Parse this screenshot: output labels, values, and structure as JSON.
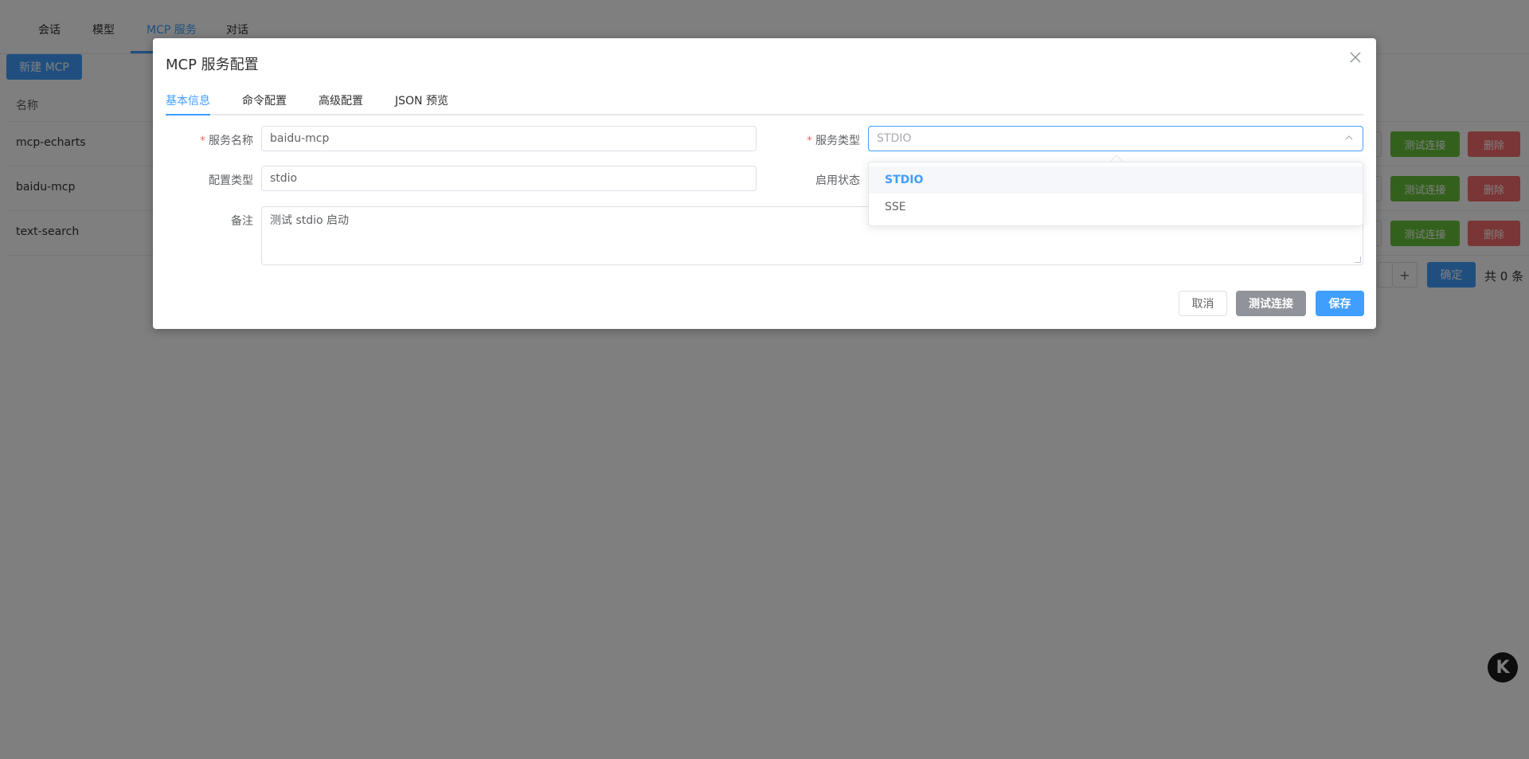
{
  "top_tabs": [
    {
      "label": "会话",
      "active": false
    },
    {
      "label": "模型",
      "active": false
    },
    {
      "label": "MCP 服务",
      "active": true
    },
    {
      "label": "对话",
      "active": false
    }
  ],
  "list": {
    "new_button": "新建 MCP",
    "column_name": "名称",
    "rows": [
      {
        "name": "mcp-echarts",
        "test_label": "测试连接",
        "delete_label": "删除"
      },
      {
        "name": "baidu-mcp",
        "test_label": "测试连接",
        "delete_label": "删除"
      },
      {
        "name": "text-search",
        "test_label": "测试连接",
        "delete_label": "删除"
      }
    ],
    "pager": {
      "plus": "+",
      "ok_label": "确定",
      "total": "共 0 条"
    }
  },
  "dialog": {
    "title": "MCP 服务配置",
    "close_icon": "close-icon",
    "tabs": [
      {
        "label": "基本信息",
        "active": true
      },
      {
        "label": "命令配置",
        "active": false
      },
      {
        "label": "高级配置",
        "active": false
      },
      {
        "label": "JSON 预览",
        "active": false
      }
    ],
    "form": {
      "service_name_label": "服务名称",
      "service_name_value": "baidu-mcp",
      "service_type_label": "服务类型",
      "service_type_placeholder": "STDIO",
      "config_type_label": "配置类型",
      "config_type_value": "stdio",
      "enable_status_label": "启用状态",
      "remark_label": "备注",
      "remark_value": "测试 stdio 启动"
    },
    "dropdown": {
      "options": [
        {
          "label": "STDIO",
          "selected": true
        },
        {
          "label": "SSE",
          "selected": false
        }
      ]
    },
    "footer": {
      "cancel_label": "取消",
      "test_label": "测试连接",
      "save_label": "保存"
    }
  },
  "floating_logo": "K",
  "colors": {
    "primary": "#409eff",
    "success": "#67c23a",
    "danger": "#f56c6c",
    "info": "#909399"
  }
}
